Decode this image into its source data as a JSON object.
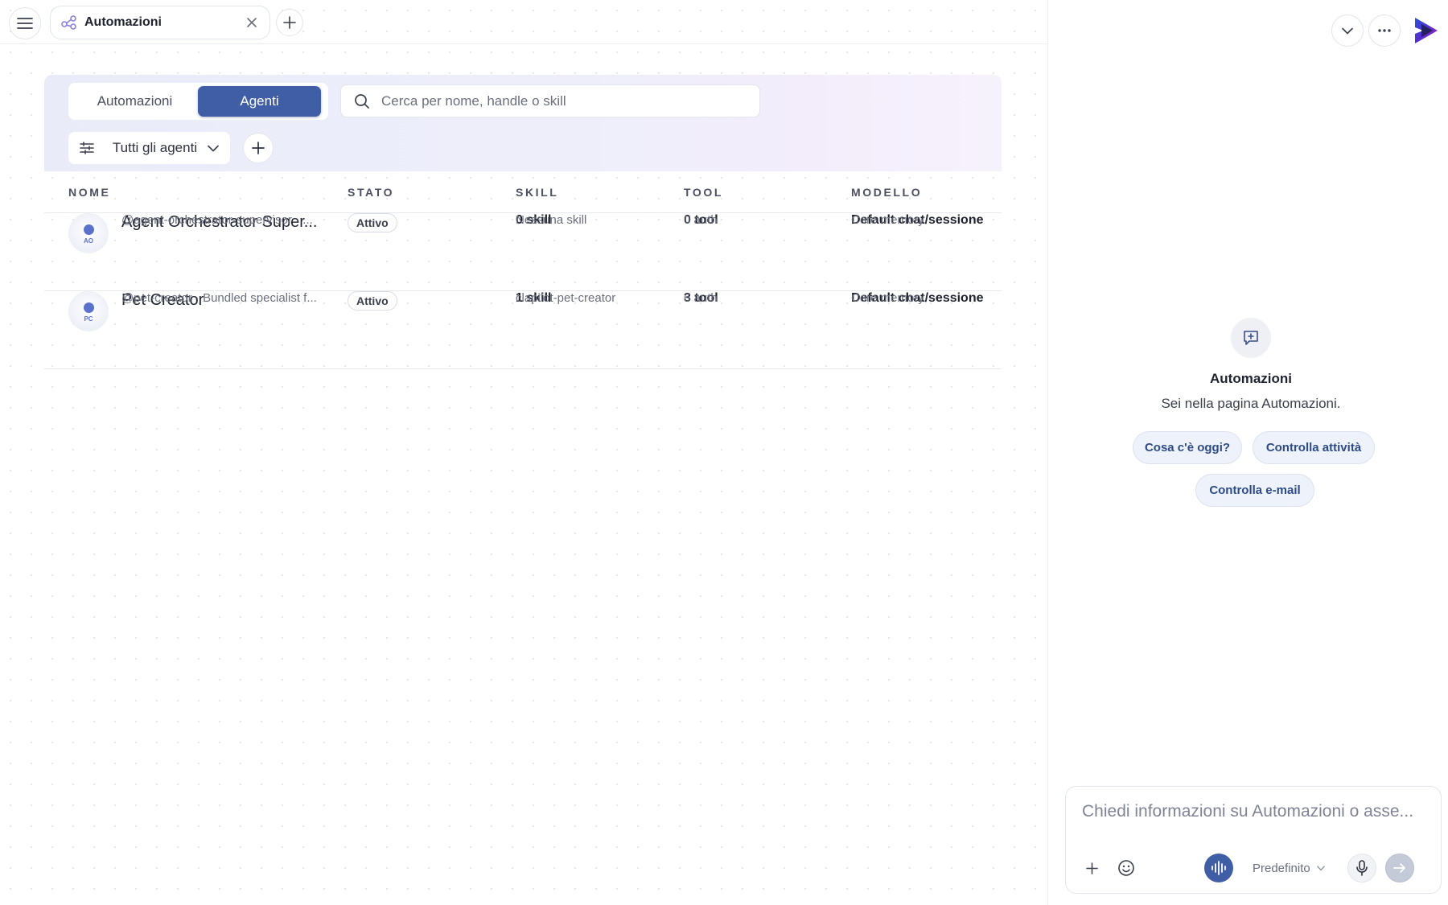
{
  "tabs": {
    "active_label": "Automazioni"
  },
  "main": {
    "segment": {
      "items": [
        "Automazioni",
        "Agenti"
      ],
      "selected": "Agenti"
    },
    "search": {
      "placeholder": "Cerca per nome, handle o skill",
      "value": ""
    },
    "filter": {
      "label": "Tutti gli agenti"
    },
    "table": {
      "columns": [
        "NOME",
        "STATO",
        "SKILL",
        "TOOL",
        "MODELLO"
      ],
      "rows": [
        {
          "initials": "AO",
          "name": "Agent Orchestrator Super...",
          "handle": "@agent-orchestrator-supervisor · ...",
          "status": "Attivo",
          "skill": "0 skill",
          "skill_detail": "Nessuna skill",
          "tool": "0 tool",
          "tool_detail": "0 auth",
          "model": "Default chat/sessione",
          "model_detail": "Core memory"
        },
        {
          "initials": "PC",
          "name": "Pet Creator",
          "handle": "@pet-creator · Bundled specialist f...",
          "status": "Attivo",
          "skill": "1 skill",
          "skill_detail": "clapilot-pet-creator",
          "tool": "3 tool",
          "tool_detail": "6 auth",
          "model": "Default chat/sessione",
          "model_detail": "Core memory"
        }
      ]
    }
  },
  "assistant": {
    "title": "Automazioni",
    "subtitle": "Sei nella pagina Automazioni.",
    "suggestions": [
      "Cosa c'è oggi?",
      "Controlla attività",
      "Controlla e-mail"
    ],
    "composer_placeholder": "Chiedi informazioni su Automazioni o asse...",
    "model_label": "Predefinito"
  },
  "colors": {
    "accent": "#3f5ea5",
    "avatar_accent": "#5a72cc",
    "chip_text": "#2d4b86"
  },
  "icons": {
    "menu": "hamburger-icon",
    "tab": "workflow-icon",
    "close": "close-icon",
    "add": "plus-icon",
    "search": "search-icon",
    "filter": "sliders-icon",
    "chevron": "chevron-down-icon",
    "more": "ellipsis-icon",
    "new_chat": "chat-plus-icon",
    "emoji": "emoji-icon",
    "voice": "waveform-icon",
    "mic": "microphone-icon",
    "send": "arrow-right-icon"
  }
}
